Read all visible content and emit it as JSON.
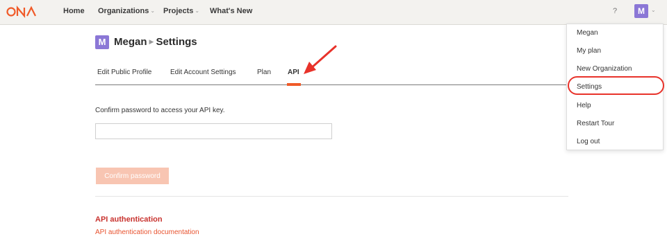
{
  "nav": {
    "logo_text": "ONA",
    "items": [
      {
        "label": "Home",
        "has_dropdown": false
      },
      {
        "label": "Organizations",
        "has_dropdown": true
      },
      {
        "label": "Projects",
        "has_dropdown": true
      },
      {
        "label": "What's New",
        "has_dropdown": false
      }
    ],
    "help_label": "?",
    "avatar_initial": "M",
    "accent_color": "#f05a28",
    "avatar_color": "#8b77d6"
  },
  "header": {
    "avatar_initial": "M",
    "user": "Megan",
    "page": "Settings"
  },
  "tabs": [
    {
      "label": "Edit Public Profile",
      "active": false
    },
    {
      "label": "Edit Account Settings",
      "active": false
    },
    {
      "label": "Plan",
      "active": false
    },
    {
      "label": "API",
      "active": true
    }
  ],
  "form": {
    "prompt": "Confirm password to access your API key.",
    "password_value": "",
    "button_label": "Confirm password"
  },
  "api_auth": {
    "title": "API authentication",
    "link_label": "API authentication documentation"
  },
  "user_menu": {
    "items": [
      "Megan",
      "My plan",
      "New Organization",
      "Settings",
      "Help",
      "Restart Tour",
      "Log out"
    ],
    "highlighted": "Settings"
  },
  "annotation": {
    "arrow_color": "#e8322a"
  }
}
